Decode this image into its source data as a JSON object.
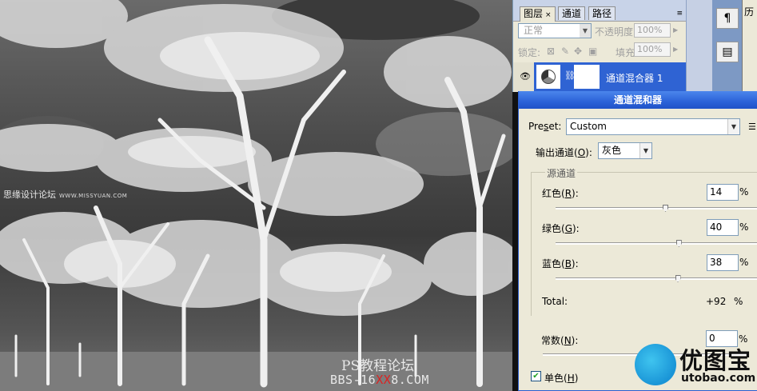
{
  "canvas": {
    "watermark_top": "思缘设计论坛",
    "watermark_top_url": "WWW.MISSYUAN.COM",
    "watermark_bottom_title": "PS教程论坛",
    "watermark_bottom_url_a": "BBS-16",
    "watermark_bottom_url_xx": "XX",
    "watermark_bottom_url_b": "8.COM"
  },
  "layers_panel": {
    "tabs": [
      {
        "label": "图层",
        "close": "×"
      },
      {
        "label": "通道"
      },
      {
        "label": "路径"
      }
    ],
    "menu_icon": "≡",
    "blend_mode": "正常",
    "opacity_label": "不透明度:",
    "opacity_value": "100%",
    "lock_label": "锁定:",
    "fill_label": "填充:",
    "fill_value": "100%",
    "layer_name": "通道混合器 1",
    "visibility_icon": "eye-icon",
    "link_icon": "chain-icon"
  },
  "side_panel": {
    "history_tab": "历",
    "tool_buttons": [
      "¶",
      "▤"
    ]
  },
  "mixer": {
    "title": "通道混和器",
    "preset_label_a": "Pre",
    "preset_label_s": "s",
    "preset_label_b": "et:",
    "preset_value": "Custom",
    "preset_menu_icon": "list-icon",
    "output_label_a": "输出通道(",
    "output_label_key": "O",
    "output_label_b": "):",
    "output_value": "灰色",
    "source_group_label": "源通道",
    "channels": [
      {
        "label_a": "红色(",
        "key": "R",
        "label_b": "):",
        "value": "14",
        "unit": "%",
        "level": 14
      },
      {
        "label_a": "绿色(",
        "key": "G",
        "label_b": "):",
        "value": "40",
        "unit": "%",
        "level": 40
      },
      {
        "label_a": "蓝色(",
        "key": "B",
        "label_b": "):",
        "value": "38",
        "unit": "%",
        "level": 38
      }
    ],
    "total_label": "Total:",
    "total_value": "+92",
    "total_unit": "%",
    "constant_label_a": "常数(",
    "constant_key": "N",
    "constant_label_b": "):",
    "constant_value": "0",
    "constant_unit": "%",
    "constant_level": 0,
    "mono_checked": true,
    "mono_label_a": "单色(",
    "mono_key": "H",
    "mono_label_b": ")"
  },
  "logo": {
    "brand": "优图宝",
    "domain": "utobao.com"
  }
}
